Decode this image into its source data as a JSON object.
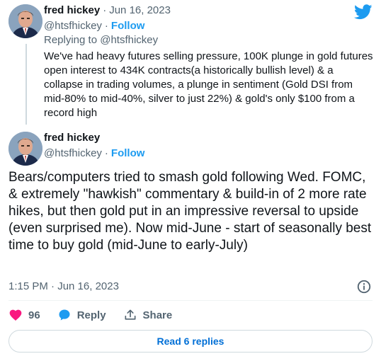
{
  "colors": {
    "brand": "#1d9bf0",
    "like": "#f91880",
    "muted": "#536471",
    "text": "#0f1419",
    "border": "#cfd9de"
  },
  "reply_tweet": {
    "author_name": "fred hickey",
    "date": "Jun 16, 2023",
    "handle": "@htsfhickey",
    "follow_label": "Follow",
    "replying_to": "Replying to @htsfhickey",
    "text": "We've had heavy futures selling pressure, 100K plunge in gold futures open interest to 434K contracts(a historically bullish level) & a collapse in trading volumes, a plunge in sentiment (Gold DSI from mid-80% to mid-40%, silver to just 22%) & gold's only $100 from a record high"
  },
  "main_tweet": {
    "author_name": "fred hickey",
    "handle": "@htsfhickey",
    "follow_label": "Follow",
    "text": "Bears/computers tried to smash gold following Wed. FOMC, & extremely \"hawkish\" commentary & build-in of 2 more rate hikes, but then gold put in an impressive reversal to upside (even surprised me). Now mid-June - start of seasonally best time to buy gold (mid-June to early-July)",
    "timestamp": "1:15 PM · Jun 16, 2023"
  },
  "actions": {
    "like_count": "96",
    "reply_label": "Reply",
    "share_label": "Share"
  },
  "read_replies_label": "Read 6 replies",
  "separator": "·",
  "icons": [
    "twitter-bird-icon",
    "heart-icon",
    "reply-bubble-icon",
    "share-icon",
    "info-icon"
  ]
}
